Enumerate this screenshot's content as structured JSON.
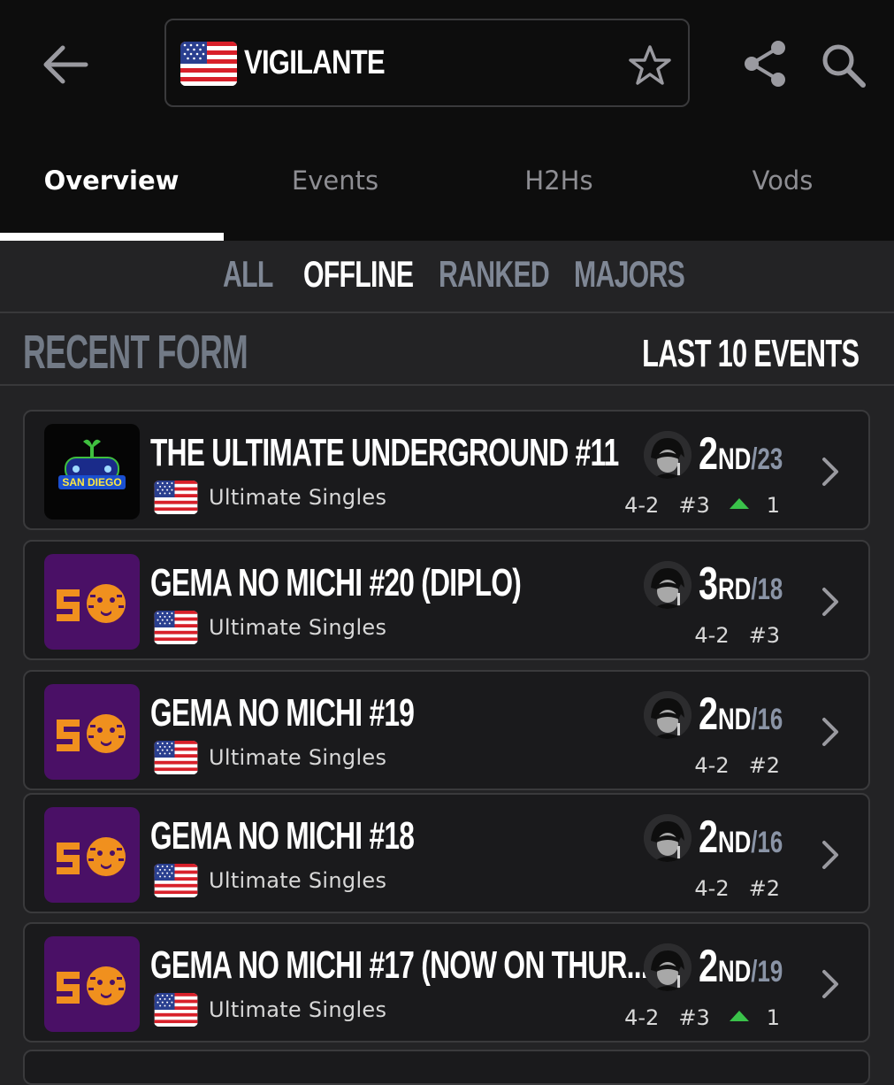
{
  "header": {
    "back_icon": "arrow-left-icon",
    "player_name": "VIGILANTE",
    "player_flag": "us-flag-icon",
    "favorite_icon": "star-outline-icon",
    "share_icon": "share-icon",
    "search_icon": "search-icon"
  },
  "tabs": [
    {
      "label": "Overview",
      "active": true
    },
    {
      "label": "Events",
      "active": false
    },
    {
      "label": "H2Hs",
      "active": false
    },
    {
      "label": "Vods",
      "active": false
    }
  ],
  "filters": [
    {
      "label": "ALL",
      "active": false
    },
    {
      "label": "OFFLINE",
      "active": true
    },
    {
      "label": "RANKED",
      "active": false
    },
    {
      "label": "MAJORS",
      "active": false
    }
  ],
  "recent_form": {
    "title": "RECENT FORM",
    "range_label": "LAST 10 EVENTS"
  },
  "events": [
    {
      "name": "THE ULTIMATE UNDERGROUND #11",
      "logo": "san-diego-logo",
      "logo_text": "SAN DIEGO",
      "game": "Ultimate Singles",
      "place": "2",
      "suffix": "ND",
      "total": "/23",
      "record": "4-2",
      "seed": "#3",
      "upset": "1"
    },
    {
      "name": "GEMA NO MICHI #20 (DIPLO)",
      "logo": "gema-no-michi-logo",
      "game": "Ultimate Singles",
      "place": "3",
      "suffix": "RD",
      "total": "/18",
      "record": "4-2",
      "seed": "#3",
      "upset": ""
    },
    {
      "name": "GEMA NO MICHI #19",
      "logo": "gema-no-michi-logo",
      "game": "Ultimate Singles",
      "place": "2",
      "suffix": "ND",
      "total": "/16",
      "record": "4-2",
      "seed": "#2",
      "upset": ""
    },
    {
      "name": "GEMA NO MICHI #18",
      "logo": "gema-no-michi-logo",
      "game": "Ultimate Singles",
      "place": "2",
      "suffix": "ND",
      "total": "/16",
      "record": "4-2",
      "seed": "#2",
      "upset": ""
    },
    {
      "name": "GEMA NO MICHI #17 (NOW ON THUR...",
      "logo": "gema-no-michi-logo",
      "game": "Ultimate Singles",
      "place": "2",
      "suffix": "ND",
      "total": "/19",
      "record": "4-2",
      "seed": "#3",
      "upset": "1"
    }
  ],
  "colors": {
    "background": "#232325",
    "topbar": "#0d0d0d",
    "card": "#1a1a1c",
    "accent_up": "#3ac24a",
    "muted_heading": "#727a86",
    "gema_purple": "#4a1066",
    "gema_orange": "#f0901e"
  }
}
